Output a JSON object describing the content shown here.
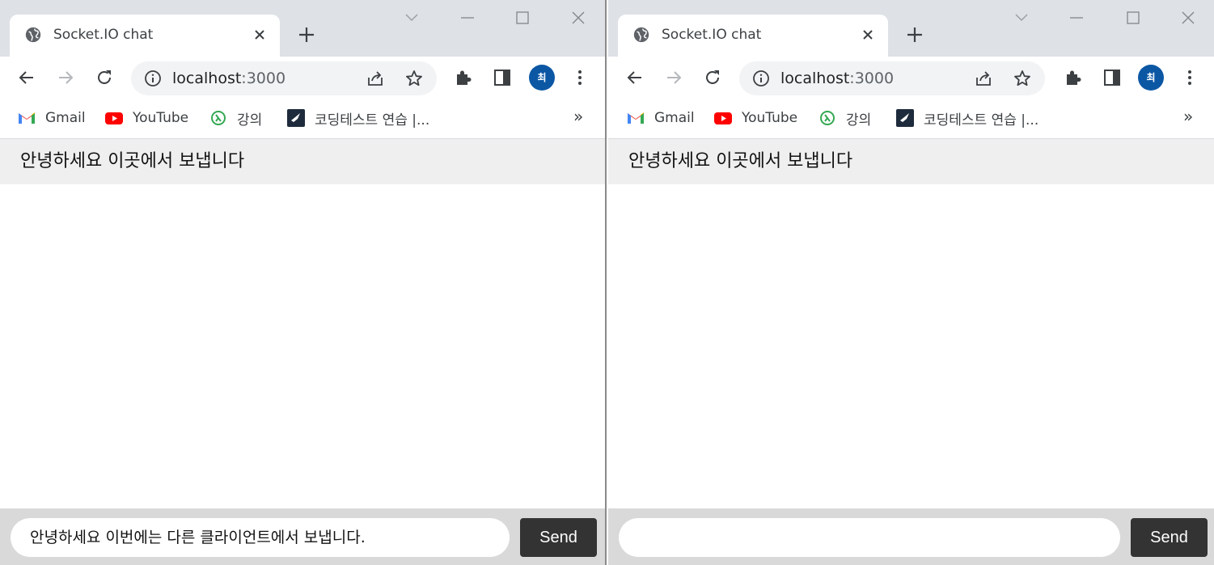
{
  "left_window": {
    "tab": {
      "title": "Socket.IO chat"
    },
    "omnibox": {
      "host": "localhost",
      "port": ":3000"
    },
    "avatar_initial": "최",
    "bookmarks": [
      {
        "label": "Gmail",
        "icon": "gmail-icon"
      },
      {
        "label": "YouTube",
        "icon": "youtube-icon"
      },
      {
        "label": "강의",
        "icon": "lecture-icon"
      },
      {
        "label": "코딩테스트 연습 |...",
        "icon": "programmers-icon"
      }
    ],
    "bookmarks_more": "»",
    "messages": [
      "안녕하세요 이곳에서 보냅니다"
    ],
    "input_value": "안녕하세요 이번에는 다른 클라이언트에서 보냅니다.",
    "send_label": "Send"
  },
  "right_window": {
    "tab": {
      "title": "Socket.IO chat"
    },
    "omnibox": {
      "host": "localhost",
      "port": ":3000"
    },
    "avatar_initial": "최",
    "bookmarks": [
      {
        "label": "Gmail",
        "icon": "gmail-icon"
      },
      {
        "label": "YouTube",
        "icon": "youtube-icon"
      },
      {
        "label": "강의",
        "icon": "lecture-icon"
      },
      {
        "label": "코딩테스트 연습 |...",
        "icon": "programmers-icon"
      }
    ],
    "bookmarks_more": "»",
    "messages": [
      "안녕하세요 이곳에서 보냅니다"
    ],
    "input_value": "",
    "send_label": "Send"
  },
  "colors": {
    "titlebar": "#dee1e6",
    "message_bg": "#efefef",
    "form_bg": "#d9d9d9",
    "send_bg": "#333333",
    "avatar_bg": "#0b57a4"
  }
}
